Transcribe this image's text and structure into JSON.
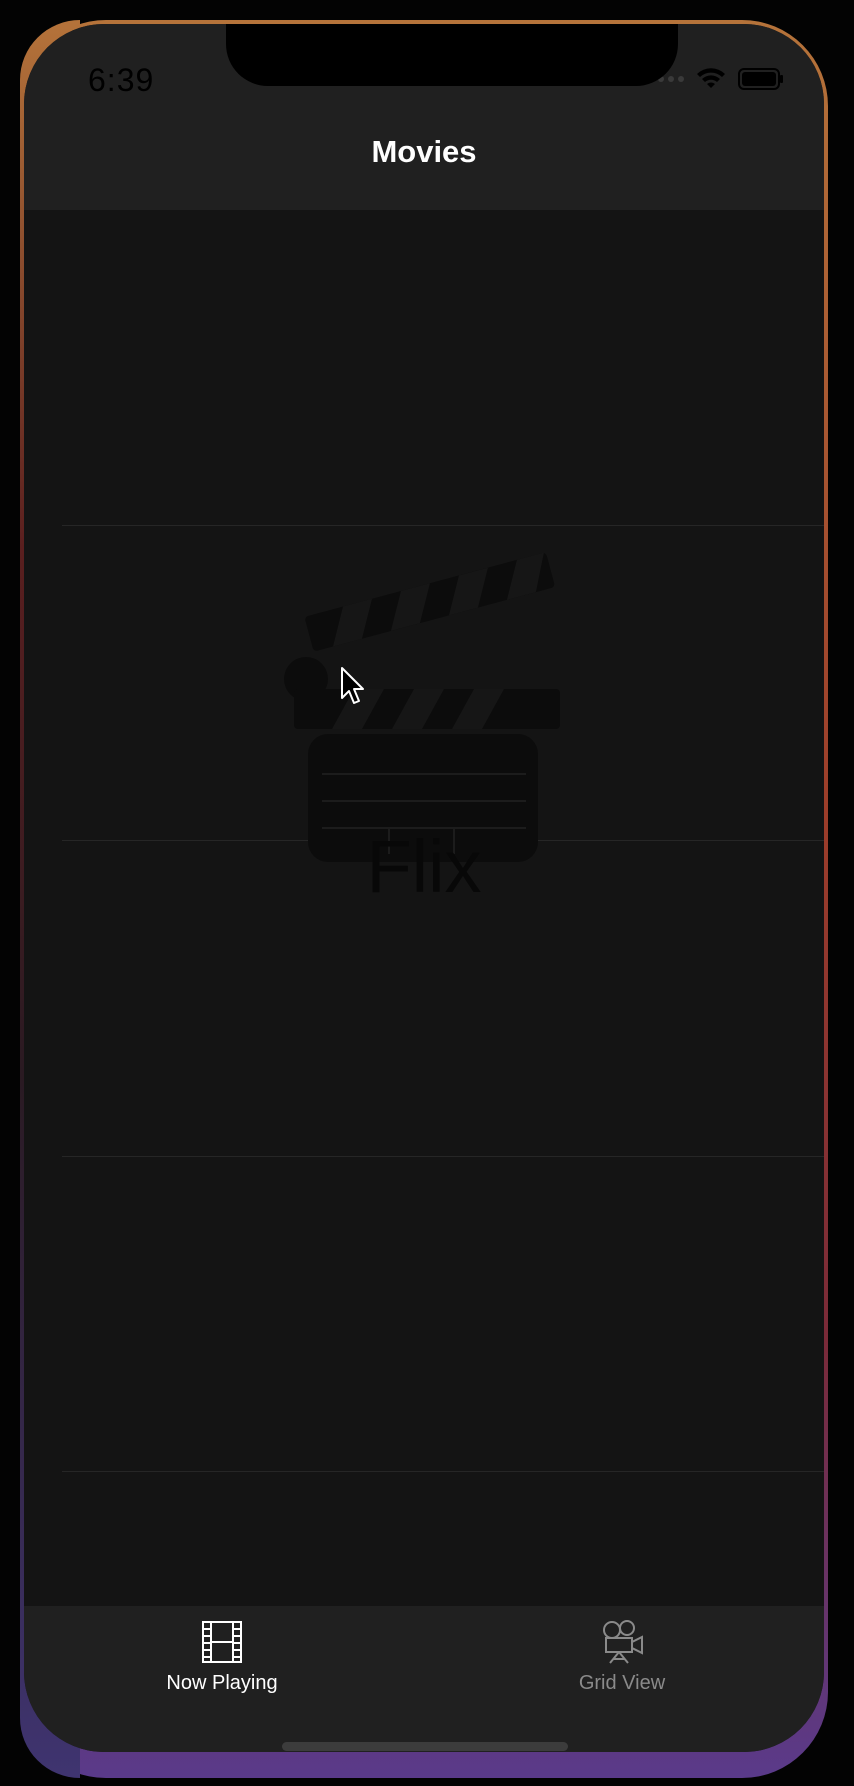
{
  "status_bar": {
    "time": "6:39",
    "icons": [
      "signal-dots-icon",
      "wifi-icon",
      "battery-icon"
    ]
  },
  "nav_bar": {
    "title": "Movies"
  },
  "splash": {
    "icon": "clapperboard-icon",
    "title": "Flix"
  },
  "tab_bar": {
    "tabs": [
      {
        "label": "Now Playing",
        "icon": "film-strip-icon",
        "active": true
      },
      {
        "label": "Grid View",
        "icon": "movie-camera-icon",
        "active": false
      }
    ]
  },
  "colors": {
    "background": "#141414",
    "bar": "#202020",
    "active_tab": "#ffffff",
    "inactive_tab": "#8a8a8a"
  }
}
